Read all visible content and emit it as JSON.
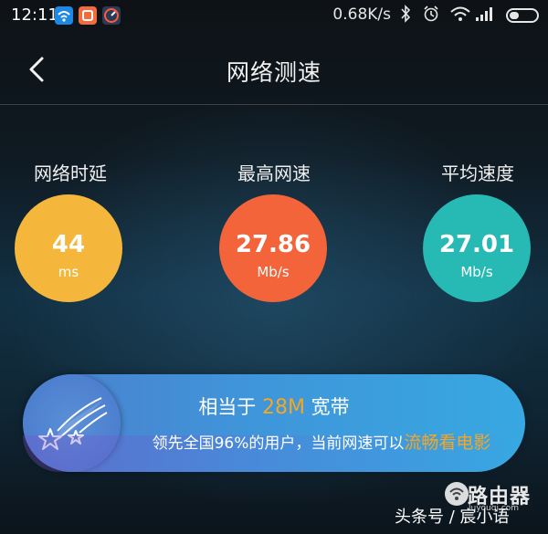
{
  "status_bar": {
    "time": "12:11",
    "speed": "0.68K/s"
  },
  "header": {
    "title": "网络测速"
  },
  "metrics": [
    {
      "label": "网络时延",
      "value": "44",
      "unit": "ms",
      "color": "#f4b73b"
    },
    {
      "label": "最高网速",
      "value": "27.86",
      "unit": "Mb/s",
      "color": "#f4643a"
    },
    {
      "label": "平均速度",
      "value": "27.01",
      "unit": "Mb/s",
      "color": "#27b9b3"
    }
  ],
  "banner": {
    "prefix": "相当于",
    "bandwidth": "28M",
    "suffix": "宽带",
    "line2": "领先全国96%的用户，当前网速可以",
    "line2_highlight": "流畅看电影"
  },
  "watermark": {
    "brand": "路由器",
    "url": "luyouqi.com",
    "author": "头条号 / 宸小语"
  }
}
